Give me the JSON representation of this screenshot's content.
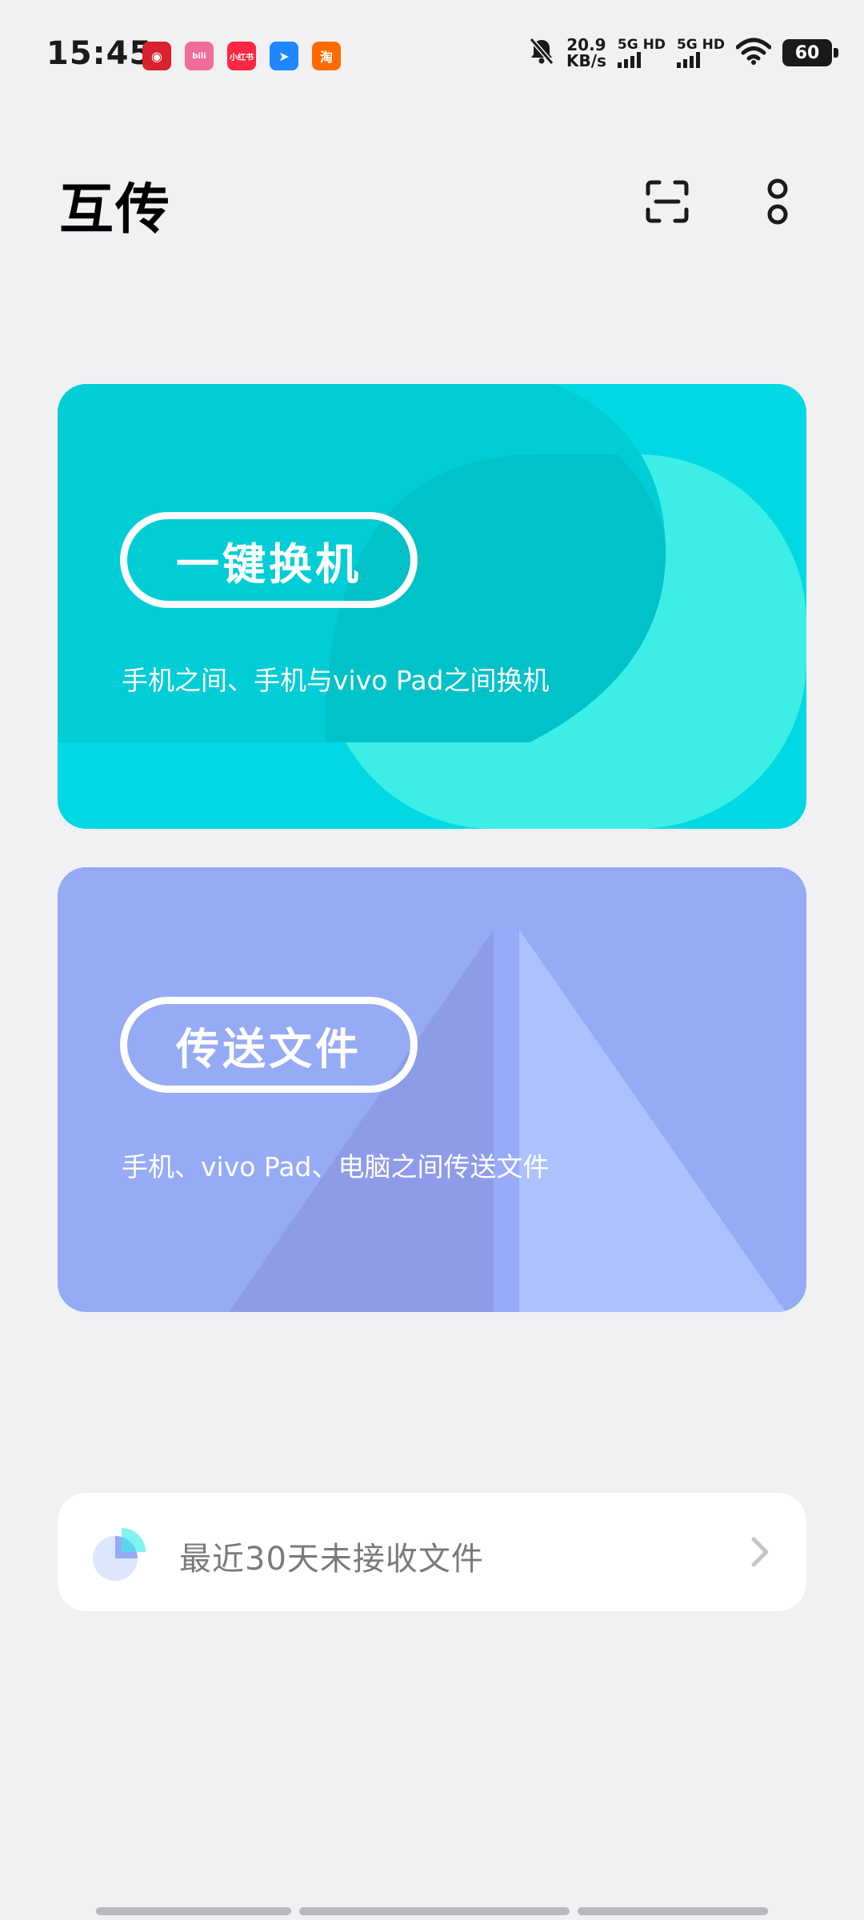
{
  "status_bar": {
    "time": "15:45",
    "app_icons": [
      {
        "name": "netease-music-icon",
        "label": "◉",
        "color": "#d8232f"
      },
      {
        "name": "bilibili-icon",
        "label": "bili",
        "color": "#f06d9a"
      },
      {
        "name": "xiaohongshu-icon",
        "label": "小红书",
        "color": "#ff2741"
      },
      {
        "name": "feishu-icon",
        "label": "➤",
        "color": "#1f86ff"
      },
      {
        "name": "taobao-icon",
        "label": "淘",
        "color": "#ff6a00"
      }
    ],
    "net_speed_value": "20.9",
    "net_speed_unit": "KB/s",
    "sim1_label": "5G HD",
    "sim2_label": "5G HD",
    "battery": "60"
  },
  "header": {
    "title": "互传",
    "scan_icon": "scan-icon",
    "more_icon": "more-icon"
  },
  "cards": {
    "switch_phone": {
      "label": "一键换机",
      "description": "手机之间、手机与vivo Pad之间换机",
      "color": "#00d9e3"
    },
    "send_files": {
      "label": "传送文件",
      "description": "手机、vivo Pad、电脑之间传送文件",
      "color": "#96abf6"
    }
  },
  "recent": {
    "label": "最近30天未接收文件",
    "icon": "pie-chart-icon",
    "chevron": "chevron-right-icon"
  }
}
